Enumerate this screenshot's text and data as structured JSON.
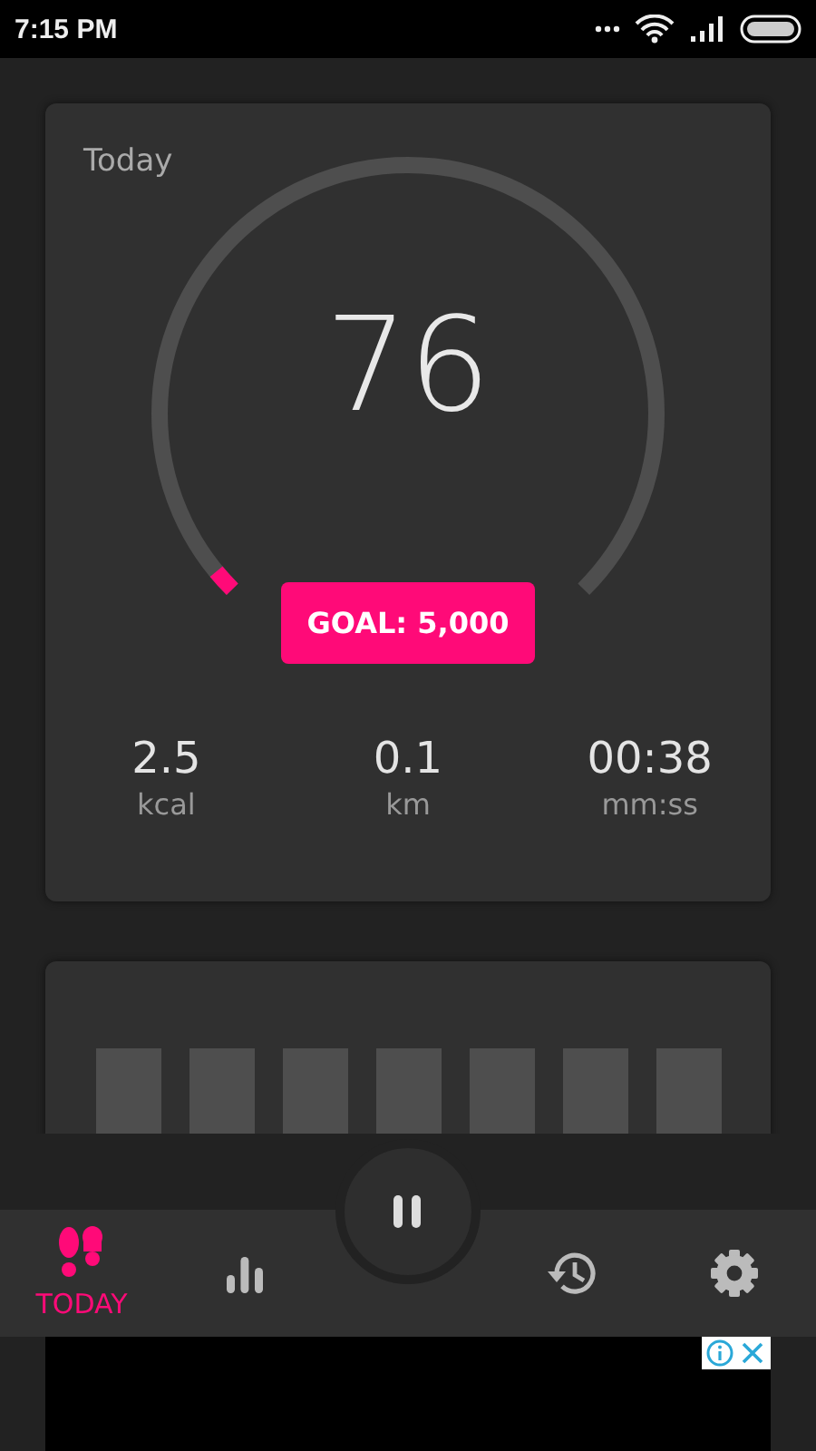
{
  "status_bar": {
    "time": "7:15 PM"
  },
  "today_card": {
    "label": "Today",
    "steps": "76",
    "goal_button": "GOAL: 5,000",
    "stats": [
      {
        "value": "2.5",
        "unit": "kcal"
      },
      {
        "value": "0.1",
        "unit": "km"
      },
      {
        "value": "00:38",
        "unit": "mm:ss"
      }
    ]
  },
  "nav": {
    "tabs": [
      {
        "kind": "today",
        "label": "TODAY",
        "selected": true
      },
      {
        "kind": "stats",
        "selected": false
      },
      {
        "kind": "history",
        "selected": false
      },
      {
        "kind": "settings",
        "selected": false
      }
    ]
  }
}
